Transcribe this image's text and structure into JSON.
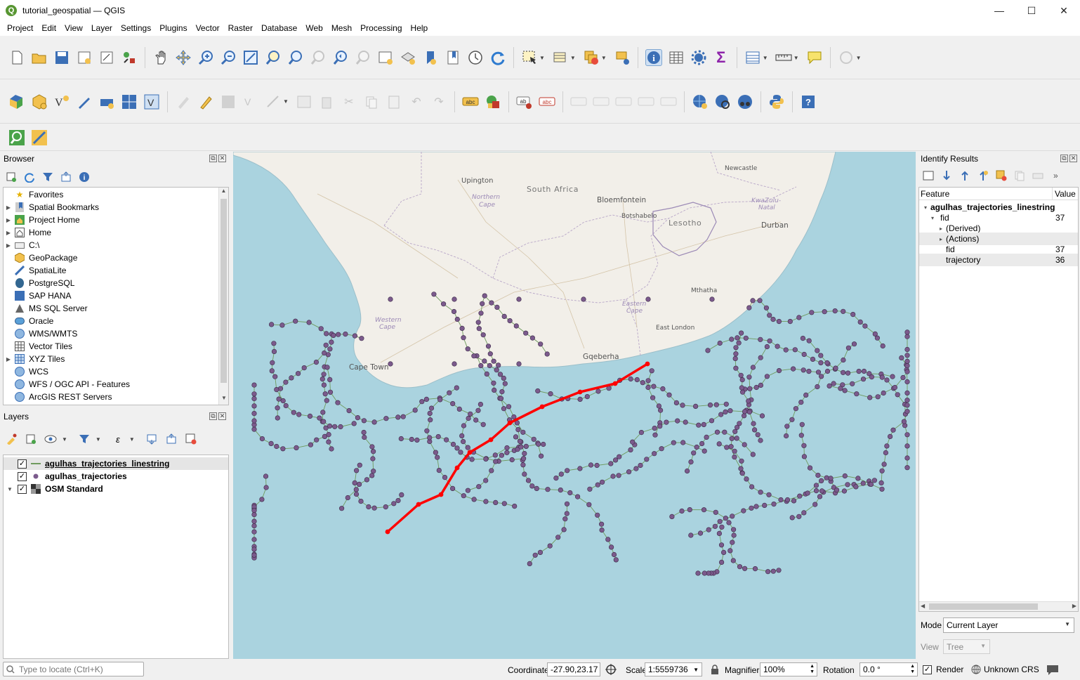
{
  "window": {
    "title": "tutorial_geospatial — QGIS",
    "logo": "Q",
    "minimize": "—",
    "maximize": "☐",
    "close": "✕"
  },
  "menu": [
    "Project",
    "Edit",
    "View",
    "Layer",
    "Settings",
    "Plugins",
    "Vector",
    "Raster",
    "Database",
    "Web",
    "Mesh",
    "Processing",
    "Help"
  ],
  "browser": {
    "title": "Browser",
    "items": [
      {
        "label": "Favorites",
        "icon": "favorites-star-icon"
      },
      {
        "label": "Spatial Bookmarks",
        "icon": "bookmarks-icon"
      },
      {
        "label": "Project Home",
        "icon": "project-home-icon"
      },
      {
        "label": "Home",
        "icon": "home-icon"
      },
      {
        "label": "C:\\",
        "icon": "drive-icon"
      },
      {
        "label": "GeoPackage",
        "icon": "geopackage-icon"
      },
      {
        "label": "SpatiaLite",
        "icon": "spatialite-icon"
      },
      {
        "label": "PostgreSQL",
        "icon": "postgresql-icon"
      },
      {
        "label": "SAP HANA",
        "icon": "sap-hana-icon"
      },
      {
        "label": "MS SQL Server",
        "icon": "mssql-icon"
      },
      {
        "label": "Oracle",
        "icon": "oracle-icon"
      },
      {
        "label": "WMS/WMTS",
        "icon": "wms-icon"
      },
      {
        "label": "Vector Tiles",
        "icon": "vector-tiles-icon"
      },
      {
        "label": "XYZ Tiles",
        "icon": "xyz-tiles-icon"
      },
      {
        "label": "WCS",
        "icon": "wcs-icon"
      },
      {
        "label": "WFS / OGC API - Features",
        "icon": "wfs-icon"
      },
      {
        "label": "ArcGIS REST Servers",
        "icon": "arcgis-icon"
      }
    ]
  },
  "layers": {
    "title": "Layers",
    "items": [
      {
        "label": "agulhas_trajectories_linestring",
        "checked": true,
        "icon": "line-layer-icon"
      },
      {
        "label": "agulhas_trajectories",
        "checked": true,
        "icon": "point-layer-icon"
      },
      {
        "label": "OSM Standard",
        "checked": true,
        "icon": "raster-layer-icon"
      }
    ]
  },
  "map": {
    "labels": [
      {
        "text": "Upington",
        "cls": "town"
      },
      {
        "text": "South Africa",
        "cls": "country"
      },
      {
        "text": "Bloemfontein",
        "cls": "town"
      },
      {
        "text": "Botshabelo",
        "cls": "small"
      },
      {
        "text": "Newcastle",
        "cls": "small"
      },
      {
        "text": "KwaZulu-",
        "cls": "prov"
      },
      {
        "text": "Natal",
        "cls": "prov"
      },
      {
        "text": "Durban",
        "cls": "town"
      },
      {
        "text": "Lesotho",
        "cls": "country"
      },
      {
        "text": "Northern",
        "cls": "prov"
      },
      {
        "text": "Cape",
        "cls": "prov"
      },
      {
        "text": "Mthatha",
        "cls": "small"
      },
      {
        "text": "Eastern",
        "cls": "prov"
      },
      {
        "text": "Cape",
        "cls": "prov"
      },
      {
        "text": "East London",
        "cls": "small"
      },
      {
        "text": "Western",
        "cls": "prov"
      },
      {
        "text": "Cape",
        "cls": "prov"
      },
      {
        "text": "Cape Town",
        "cls": "town"
      },
      {
        "text": "Gqeberha",
        "cls": "town"
      }
    ],
    "colors": {
      "sea": "#aad3df",
      "land": "#f2efe9",
      "point": "#7b5a8c",
      "line": "#6f9a5e",
      "selection": "#ff0000"
    }
  },
  "identify": {
    "title": "Identify Results",
    "columns": [
      "Feature",
      "Value"
    ],
    "rows": [
      {
        "feature": "agulhas_trajectories_linestring",
        "value": "",
        "level": 0,
        "expand": "▾",
        "bold": true
      },
      {
        "feature": "fid",
        "value": "37",
        "level": 1,
        "expand": "▾"
      },
      {
        "feature": "(Derived)",
        "value": "",
        "level": 2,
        "expand": "▸"
      },
      {
        "feature": "(Actions)",
        "value": "",
        "level": 2,
        "expand": "▸"
      },
      {
        "feature": "fid",
        "value": "37",
        "level": 2,
        "expand": ""
      },
      {
        "feature": "trajectory",
        "value": "36",
        "level": 2,
        "expand": ""
      }
    ],
    "mode_label": "Mode",
    "mode_value": "Current Layer",
    "view_label": "View",
    "view_value": "Tree"
  },
  "status": {
    "locator_placeholder": "Type to locate (Ctrl+K)",
    "coordinate_label": "Coordinate",
    "coordinate_value": "-27.90,23.17",
    "scale_label": "Scale",
    "scale_value": "1:5559736",
    "magnifier_label": "Magnifier",
    "magnifier_value": "100%",
    "rotation_label": "Rotation",
    "rotation_value": "0.0 °",
    "render_label": "Render",
    "crs_label": "Unknown CRS"
  }
}
